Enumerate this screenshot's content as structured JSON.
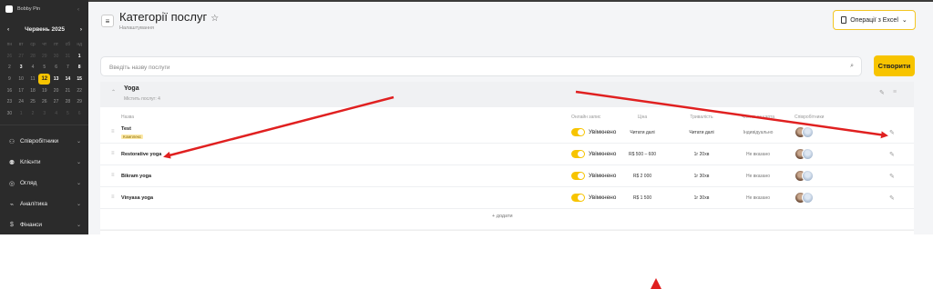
{
  "sidebar": {
    "brand": "Bobby Pin",
    "calendar": {
      "month_label": "Червень 2025",
      "weekdays": [
        "пн",
        "вт",
        "ср",
        "чт",
        "пт",
        "сб",
        "нд"
      ],
      "days": [
        {
          "d": "26",
          "k": "o"
        },
        {
          "d": "27",
          "k": "o"
        },
        {
          "d": "28",
          "k": "o"
        },
        {
          "d": "29",
          "k": "o"
        },
        {
          "d": "30",
          "k": "o"
        },
        {
          "d": "31",
          "k": "o"
        },
        {
          "d": "1",
          "k": "b"
        },
        {
          "d": "2",
          "k": "d"
        },
        {
          "d": "3",
          "k": "b"
        },
        {
          "d": "4",
          "k": "d"
        },
        {
          "d": "5",
          "k": "d"
        },
        {
          "d": "6",
          "k": "d"
        },
        {
          "d": "7",
          "k": "d"
        },
        {
          "d": "8",
          "k": "b"
        },
        {
          "d": "9",
          "k": "d"
        },
        {
          "d": "10",
          "k": "d"
        },
        {
          "d": "11",
          "k": "d"
        },
        {
          "d": "12",
          "k": "today"
        },
        {
          "d": "13",
          "k": "b"
        },
        {
          "d": "14",
          "k": "b"
        },
        {
          "d": "15",
          "k": "b"
        },
        {
          "d": "16",
          "k": "d"
        },
        {
          "d": "17",
          "k": "d"
        },
        {
          "d": "18",
          "k": "d"
        },
        {
          "d": "19",
          "k": "d"
        },
        {
          "d": "20",
          "k": "d"
        },
        {
          "d": "21",
          "k": "d"
        },
        {
          "d": "22",
          "k": "d"
        },
        {
          "d": "23",
          "k": "d"
        },
        {
          "d": "24",
          "k": "d"
        },
        {
          "d": "25",
          "k": "d"
        },
        {
          "d": "26",
          "k": "d"
        },
        {
          "d": "27",
          "k": "d"
        },
        {
          "d": "28",
          "k": "d"
        },
        {
          "d": "29",
          "k": "d"
        },
        {
          "d": "30",
          "k": "d"
        },
        {
          "d": "1",
          "k": "o"
        },
        {
          "d": "2",
          "k": "o"
        },
        {
          "d": "3",
          "k": "o"
        },
        {
          "d": "4",
          "k": "o"
        },
        {
          "d": "5",
          "k": "o"
        },
        {
          "d": "6",
          "k": "o"
        }
      ]
    },
    "menu": [
      {
        "label": "Співробітники",
        "icon": "users-icon",
        "glyph": "⚇"
      },
      {
        "label": "Клієнти",
        "icon": "clients-icon",
        "glyph": "⚉"
      },
      {
        "label": "Огляд",
        "icon": "overview-icon",
        "glyph": "◎"
      },
      {
        "label": "Аналітика",
        "icon": "analytics-icon",
        "glyph": "⌁"
      },
      {
        "label": "Фінанси",
        "icon": "finance-icon",
        "glyph": "$"
      }
    ]
  },
  "header": {
    "title": "Категорії послуг",
    "breadcrumb": "Налаштування",
    "excel_button": "Операції з Excel"
  },
  "search": {
    "placeholder": "Введіть назву послуги"
  },
  "create_button": "Створити",
  "category": {
    "title": "Yoga",
    "subtitle": "Містить послуг: 4",
    "columns": {
      "name": "Назва",
      "online": "Онлайн запис",
      "price": "Ціна",
      "duration": "Тривалість",
      "card": "Членська карта",
      "staff": "Співробітники"
    },
    "rows": [
      {
        "name": "Test",
        "tag": "Комплекс",
        "online": "Увімкнено",
        "price": "Читати далі",
        "duration": "Читати далі",
        "card": "Індивідуально"
      },
      {
        "name": "Restorative yoga",
        "tag": "",
        "online": "Увімкнено",
        "price": "R$ 500 – 600",
        "duration": "1г 20хв",
        "card": "Не вказано"
      },
      {
        "name": "Bikram yoga",
        "tag": "",
        "online": "Увімкнено",
        "price": "R$ 2 000",
        "duration": "1г 30хв",
        "card": "Не вказано"
      },
      {
        "name": "Vinyasa yoga",
        "tag": "",
        "online": "Увімкнено",
        "price": "R$ 1 500",
        "duration": "1г 30хв",
        "card": "Не вказано"
      }
    ],
    "add_label": "+ додати"
  },
  "colors": {
    "accent": "#f7c400",
    "sidebar_bg": "#2b2b2b",
    "arrow": "#e02020"
  }
}
